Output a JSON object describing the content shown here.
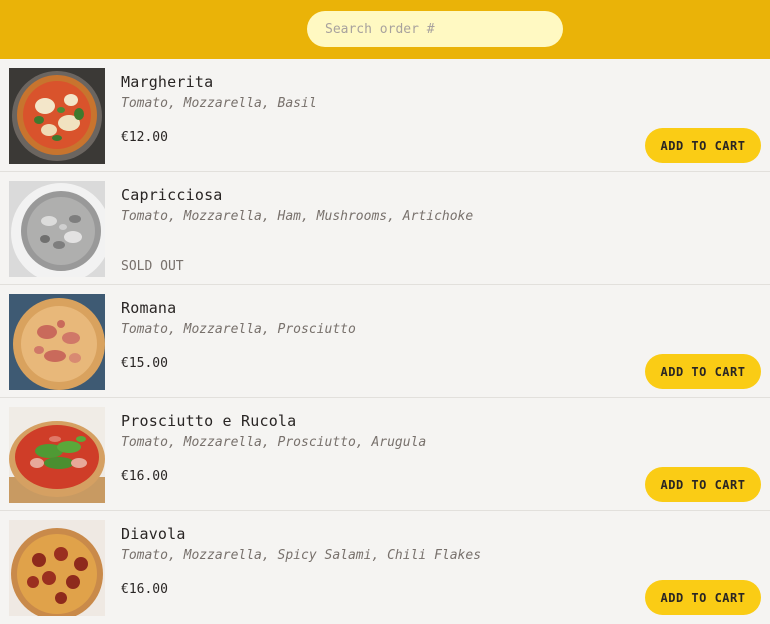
{
  "search": {
    "placeholder": "Search order #",
    "value": ""
  },
  "menu": {
    "items": [
      {
        "name": "Margherita",
        "ingredients": "Tomato, Mozzarella, Basil",
        "price": "€12.00",
        "button": "ADD TO CART",
        "image": "pizza-margherita-image"
      },
      {
        "name": "Capricciosa",
        "ingredients": "Tomato, Mozzarella, Ham, Mushrooms, Artichoke",
        "status": "SOLD OUT",
        "image": "pizza-capricciosa-image"
      },
      {
        "name": "Romana",
        "ingredients": "Tomato, Mozzarella, Prosciutto",
        "price": "€15.00",
        "button": "ADD TO CART",
        "image": "pizza-romana-image"
      },
      {
        "name": "Prosciutto e Rucola",
        "ingredients": "Tomato, Mozzarella, Prosciutto, Arugula",
        "price": "€16.00",
        "button": "ADD TO CART",
        "image": "pizza-prosciutto-rucola-image"
      },
      {
        "name": "Diavola",
        "ingredients": "Tomato, Mozzarella, Spicy Salami, Chili Flakes",
        "price": "€16.00",
        "button": "ADD TO CART",
        "image": "pizza-diavola-image"
      }
    ]
  },
  "colors": {
    "header": "#eab308",
    "button": "#facc15",
    "search_bg": "#fff9c2",
    "page_bg": "#f5f4f2"
  }
}
